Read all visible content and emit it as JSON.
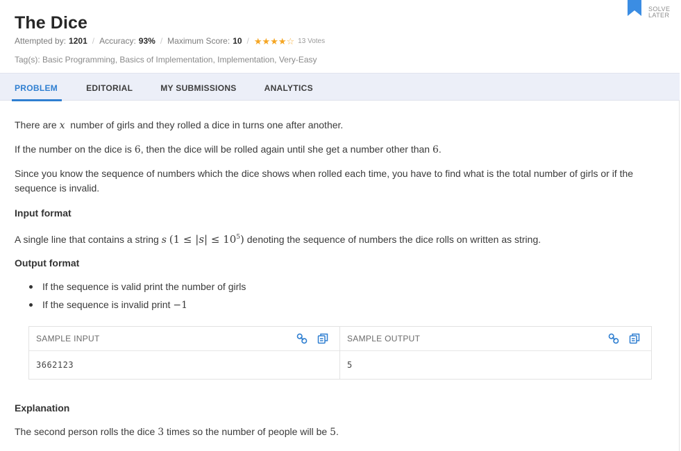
{
  "problem": {
    "title": "The Dice",
    "attempted_label": "Attempted by:",
    "attempted_value": "1201",
    "accuracy_label": "Accuracy:",
    "accuracy_value": "93%",
    "max_score_label": "Maximum Score:",
    "max_score_value": "10",
    "rating_stars": 4,
    "rating_max": 5,
    "votes": "13 Votes",
    "tags": "Tag(s): Basic Programming, Basics of Implementation, Implementation, Very-Easy"
  },
  "solve_later": {
    "line1": "SOLVE",
    "line2": "LATER",
    "icon": "bookmark-icon",
    "color": "#3b8de3"
  },
  "tabs": [
    {
      "label": "PROBLEM",
      "active": true
    },
    {
      "label": "EDITORIAL",
      "active": false
    },
    {
      "label": "MY SUBMISSIONS",
      "active": false
    },
    {
      "label": "ANALYTICS",
      "active": false
    }
  ],
  "statement": {
    "p1_before": "There are",
    "p1_var": "x",
    "p1_after": "number of girls and they rolled a dice in turns one after another.",
    "p2_before": "If the number on the dice is",
    "p2_num1": "6",
    "p2_mid": ", then the dice will be rolled again until she get a number other than",
    "p2_num2": "6",
    "p2_after": ".",
    "p3": "Since you know the sequence of numbers which the dice shows when rolled each time, you have to find what is the total number of girls or if the sequence is invalid.",
    "input_heading": "Input format",
    "input_before": "A single line that contains a string",
    "input_var": "s",
    "input_constraint_left": "(1 ≤ |",
    "input_constraint_var": "s",
    "input_constraint_right": "| ≤ 10",
    "input_constraint_exp": "5",
    "input_constraint_close": ")",
    "input_after": "denoting the sequence of numbers the dice rolls on written as string.",
    "output_heading": "Output format",
    "bullet1": "If the sequence is valid print the number of girls",
    "bullet2_before": "If the sequence is invalid print",
    "bullet2_math": "−1"
  },
  "sample": {
    "input_label": "SAMPLE INPUT",
    "input_value": "3662123",
    "output_label": "SAMPLE OUTPUT",
    "output_value": "5",
    "link_icon": "link-icon",
    "copy_icon": "copy-icon",
    "icon_color": "#2f7fd1"
  },
  "explanation": {
    "heading": "Explanation",
    "before": "The second person rolls the dice",
    "num": "3",
    "mid": "times so the number of people will be",
    "num2": "5",
    "after": "."
  }
}
